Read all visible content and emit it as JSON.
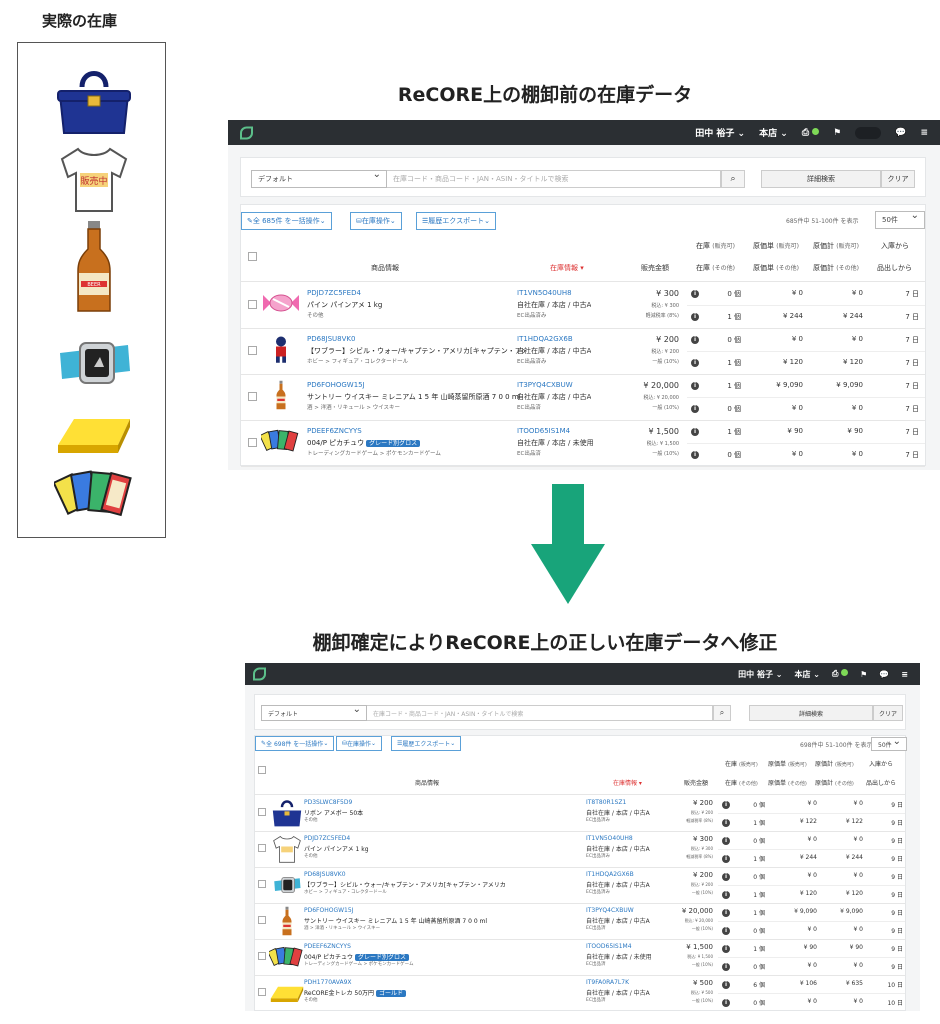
{
  "headings": {
    "actual": "実際の在庫",
    "before": "ReCORE上の棚卸前の在庫データ",
    "after": "棚卸確定によりReCORE上の正しい在庫データへ修正"
  },
  "inventory_items": [
    "bag-icon",
    "tshirt-icon",
    "beer-bottle-icon",
    "smartwatch-icon",
    "gold-bar-icon",
    "trading-cards-icon"
  ],
  "topbar": {
    "user": "田中 裕子",
    "store": "本店"
  },
  "search": {
    "select": "デフォルト",
    "placeholder": "在庫コード・商品コード・JAN・ASIN・タイトルで検索",
    "detail": "詳細検索",
    "clear": "クリア"
  },
  "actions": {
    "bulk_before": "全 685件 を一括操作",
    "bulk_after": "全 698件 を一括操作",
    "stock_ops": "在庫操作",
    "history_export": "履歴エクスポート",
    "count_before": "685件中 51-100件 を表示",
    "count_after": "698件中 51-100件 を表示",
    "per_page": "50件"
  },
  "columns": {
    "product": "商品情報",
    "stock_info": "在庫情報",
    "price": "販売金額",
    "qty_top": "在庫",
    "qty_top_sub": "(販売可)",
    "cost_top": "原価単",
    "cost_top_sub": "(販売可)",
    "total_top": "原価計",
    "total_top_sub": "(販売可)",
    "days_top": "入庫から",
    "qty_bottom": "在庫",
    "qty_bottom_sub": "(その他)",
    "cost_bottom": "原価単",
    "cost_bottom_sub": "(その他)",
    "total_bottom": "原価計",
    "total_bottom_sub": "(その他)",
    "days_bottom": "品出しから"
  },
  "rows_before": [
    {
      "code": "PDJD7ZC5FED4",
      "name": "パイン パインアメ 1 kg",
      "cat": "その他",
      "stock_code": "IT1VN5O40UH8",
      "stock_loc": "自社在庫 / 本店 / 中古A",
      "stock_sub": "EC出品済み",
      "price": "¥ 300",
      "price_sub1": "税込: ¥ 300",
      "price_sub2": "軽減税率 (8%)",
      "q1": "0 個",
      "c1": "¥ 0",
      "t1": "¥ 0",
      "d1": "7 日",
      "q2": "1 個",
      "c2": "¥ 244",
      "t2": "¥ 244",
      "d2": "7 日",
      "img": "candy"
    },
    {
      "code": "PD68JSU8VK0",
      "name": "【ワブラー】シビル・ウォー/キャプテン・アメリカ[キャプテン・アメリカ",
      "cat": "ホビー > フィギュア・コレクタードール",
      "stock_code": "IT1HDQA2GX6B",
      "stock_loc": "自社在庫 / 本店 / 中古A",
      "stock_sub": "EC出品済み",
      "price": "¥ 200",
      "price_sub1": "税込: ¥ 200",
      "price_sub2": "一般 (10%)",
      "q1": "0 個",
      "c1": "¥ 0",
      "t1": "¥ 0",
      "d1": "7 日",
      "q2": "1 個",
      "c2": "¥ 120",
      "t2": "¥ 120",
      "d2": "7 日",
      "img": "figure"
    },
    {
      "code": "PD6FOHOGW15J",
      "name": "サントリー ウイスキー ミレニアム 1 5 年 山崎蒸留所原酒 7 0 0 ml",
      "cat": "酒 > 洋酒・リキュール > ウイスキー",
      "stock_code": "IT3PYQ4CXBUW",
      "stock_loc": "自社在庫 / 本店 / 中古A",
      "stock_sub": "EC出品済",
      "price": "¥ 20,000",
      "price_sub1": "税込: ¥ 20,000",
      "price_sub2": "一般 (10%)",
      "q1": "1 個",
      "c1": "¥ 9,090",
      "t1": "¥ 9,090",
      "d1": "7 日",
      "q2": "0 個",
      "c2": "¥ 0",
      "t2": "¥ 0",
      "d2": "7 日",
      "img": "bottle"
    },
    {
      "code": "PDEEF6ZNCYYS",
      "name": "004/P ピカチュウ",
      "badge": "グレード別グロス",
      "cat": "トレーディングカードゲーム > ポケモンカードゲーム",
      "stock_code": "ITOOD65IS1M4",
      "stock_loc": "自社在庫 / 本店 / 未使用",
      "stock_sub": "EC出品済",
      "price": "¥ 1,500",
      "price_sub1": "税込: ¥ 1,500",
      "price_sub2": "一般 (10%)",
      "q1": "1 個",
      "c1": "¥ 90",
      "t1": "¥ 90",
      "d1": "7 日",
      "q2": "0 個",
      "c2": "¥ 0",
      "t2": "¥ 0",
      "d2": "7 日",
      "img": "cards"
    }
  ],
  "rows_after": [
    {
      "code": "PD3SLWC8F5D9",
      "name": "リボン アメボー 50本",
      "cat": "その他",
      "stock_code": "IT8T80R1SZ1",
      "stock_loc": "自社在庫 / 本店 / 中古A",
      "stock_sub": "EC出品済み",
      "price": "¥ 200",
      "price_sub1": "税込: ¥ 200",
      "price_sub2": "軽減税率 (8%)",
      "q1": "0 個",
      "c1": "¥ 0",
      "t1": "¥ 0",
      "d1": "9 日",
      "q2": "1 個",
      "c2": "¥ 122",
      "t2": "¥ 122",
      "d2": "9 日",
      "img": "bag"
    },
    {
      "code": "PDJD7ZC5FED4",
      "name": "パイン パインアメ 1 kg",
      "cat": "その他",
      "stock_code": "IT1VN5O40UH8",
      "stock_loc": "自社在庫 / 本店 / 中古A",
      "stock_sub": "EC出品済み",
      "price": "¥ 300",
      "price_sub1": "税込: ¥ 300",
      "price_sub2": "軽減税率 (8%)",
      "q1": "0 個",
      "c1": "¥ 0",
      "t1": "¥ 0",
      "d1": "9 日",
      "q2": "1 個",
      "c2": "¥ 244",
      "t2": "¥ 244",
      "d2": "9 日",
      "img": "shirt"
    },
    {
      "code": "PD68JSU8VK0",
      "name": "【ワブラー】シビル・ウォー/キャプテン・アメリカ[キャプテン・アメリカ",
      "cat": "ホビー > フィギュア・コレクタードール",
      "stock_code": "IT1HDQA2GX6B",
      "stock_loc": "自社在庫 / 本店 / 中古A",
      "stock_sub": "EC出品済み",
      "price": "¥ 200",
      "price_sub1": "税込: ¥ 200",
      "price_sub2": "一般 (10%)",
      "q1": "0 個",
      "c1": "¥ 0",
      "t1": "¥ 0",
      "d1": "9 日",
      "q2": "1 個",
      "c2": "¥ 120",
      "t2": "¥ 120",
      "d2": "9 日",
      "img": "watch"
    },
    {
      "code": "PD6FOHOGW15J",
      "name": "サントリー ウイスキー ミレニアム 1 5 年 山崎蒸留所原酒 7 0 0 ml",
      "cat": "酒 > 洋酒・リキュール > ウイスキー",
      "stock_code": "IT3PYQ4CXBUW",
      "stock_loc": "自社在庫 / 本店 / 中古A",
      "stock_sub": "EC出品済",
      "price": "¥ 20,000",
      "price_sub1": "税込: ¥ 20,000",
      "price_sub2": "一般 (10%)",
      "q1": "1 個",
      "c1": "¥ 9,090",
      "t1": "¥ 9,090",
      "d1": "9 日",
      "q2": "0 個",
      "c2": "¥ 0",
      "t2": "¥ 0",
      "d2": "9 日",
      "img": "bottle"
    },
    {
      "code": "PDEEF6ZNCYYS",
      "name": "004/P ピカチュウ",
      "badge": "グレード別グロス",
      "cat": "トレーディングカードゲーム > ポケモンカードゲーム",
      "stock_code": "ITOOD65IS1M4",
      "stock_loc": "自社在庫 / 本店 / 未使用",
      "stock_sub": "EC出品済",
      "price": "¥ 1,500",
      "price_sub1": "税込: ¥ 1,500",
      "price_sub2": "一般 (10%)",
      "q1": "1 個",
      "c1": "¥ 90",
      "t1": "¥ 90",
      "d1": "9 日",
      "q2": "0 個",
      "c2": "¥ 0",
      "t2": "¥ 0",
      "d2": "9 日",
      "img": "cards"
    },
    {
      "code": "PDH1770AVA9X",
      "name": "ReCORE金トレカ 50万円",
      "badge": "ゴールド",
      "cat": "その他",
      "stock_code": "IT9FA0RA7L7K",
      "stock_loc": "自社在庫 / 本店 / 中古A",
      "stock_sub": "EC出品済",
      "price": "¥ 500",
      "price_sub1": "税込: ¥ 500",
      "price_sub2": "一般 (10%)",
      "q1": "6 個",
      "c1": "¥ 106",
      "t1": "¥ 635",
      "d1": "10 日",
      "q2": "0 個",
      "c2": "¥ 0",
      "t2": "¥ 0",
      "d2": "10 日",
      "img": "gold"
    }
  ]
}
